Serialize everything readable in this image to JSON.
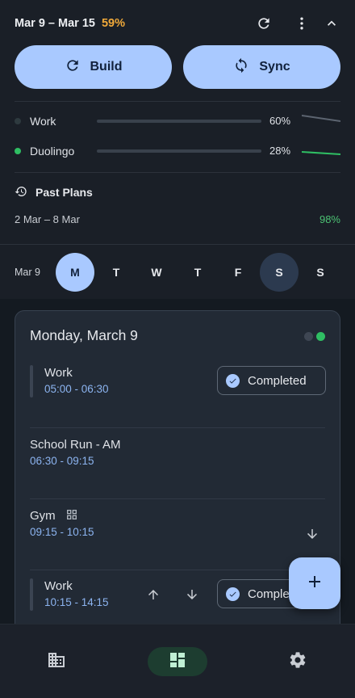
{
  "header": {
    "date_range": "Mar 9 – Mar 15",
    "percent": "59%",
    "icons": [
      "refresh-icon",
      "more-vert-icon",
      "collapse-icon"
    ]
  },
  "actions": {
    "build_label": "Build",
    "sync_label": "Sync"
  },
  "trackers": [
    {
      "name": "Work",
      "percent": "60%",
      "progress": 0,
      "dot_color": "#2e3a3f",
      "trend": "down"
    },
    {
      "name": "Duolingo",
      "percent": "28%",
      "progress": 0.28,
      "dot_color": "#2fbe63",
      "trend": "flat"
    }
  ],
  "past_plans": {
    "title": "Past Plans",
    "items": [
      {
        "range": "2 Mar – 8 Mar",
        "percent": "98%"
      }
    ]
  },
  "week": {
    "label": "Mar 9",
    "days": [
      "M",
      "T",
      "W",
      "T",
      "F",
      "S",
      "S"
    ],
    "selected_index": 0,
    "today_index": 5
  },
  "day_card": {
    "title": "Monday, March 9",
    "blocks": [
      {
        "name": "Work",
        "time": "05:00 - 06:30",
        "status": "Completed"
      },
      {
        "name": "School Run - AM",
        "time": "06:30 - 09:15"
      },
      {
        "name": "Gym",
        "time": "09:15 - 10:15"
      },
      {
        "name": "Work",
        "time": "10:15 - 14:15",
        "status": "Completed"
      }
    ]
  },
  "fab": {
    "icon": "add-icon"
  },
  "bottom_nav": {
    "items": [
      "building-icon",
      "dashboard-icon",
      "settings-icon"
    ],
    "active_index": 1
  },
  "colors": {
    "accent": "#a9c9ff",
    "warning": "#f0a93a",
    "success": "#2fbe63",
    "time_text": "#8cb4f0"
  }
}
